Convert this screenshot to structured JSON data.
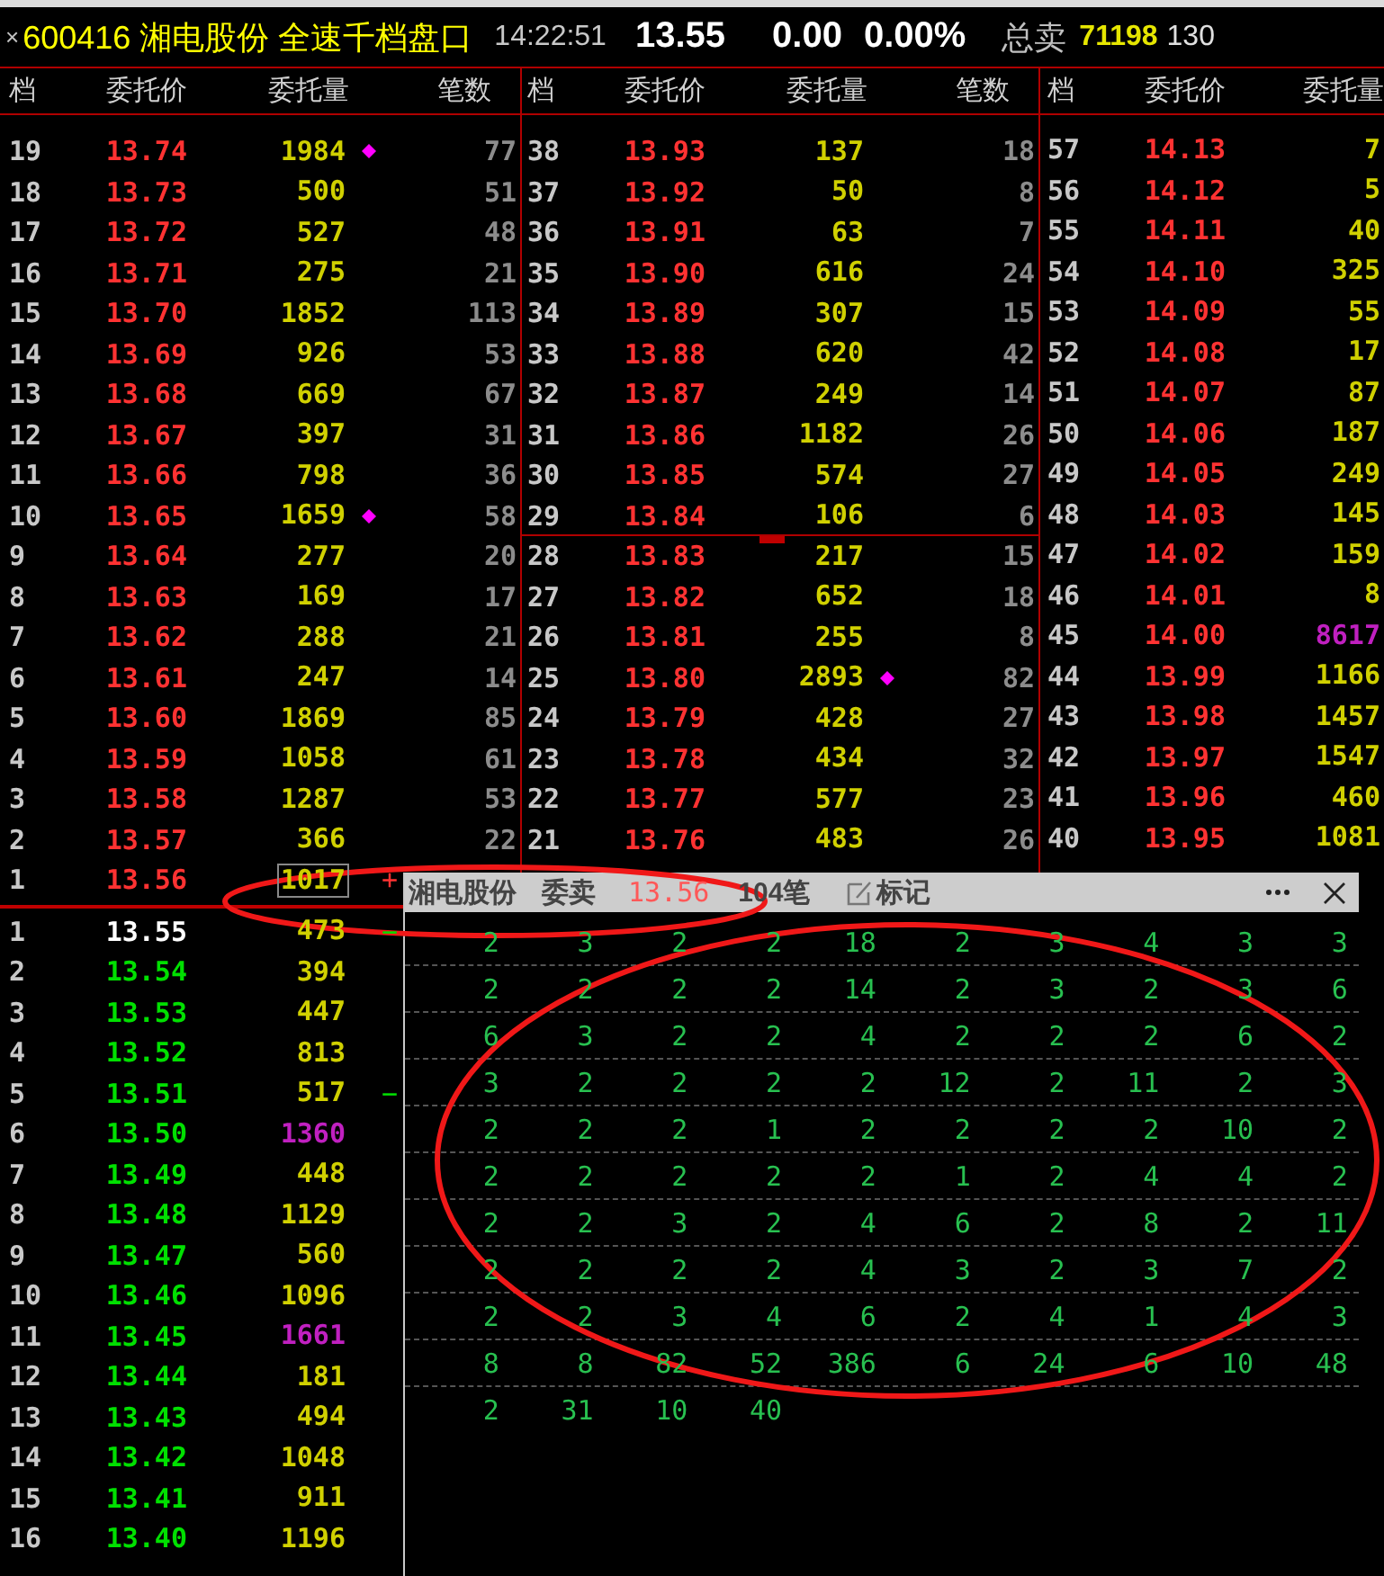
{
  "quote": {
    "close": "×",
    "title": "600416 湘电股份 全速千档盘口",
    "time": "14:22:51",
    "price": "13.55",
    "change": "0.00",
    "percent": "0.00%",
    "total_label": "总卖",
    "total_volume": "71198",
    "levels": "130"
  },
  "book": {
    "panels": [
      {
        "columns": [
          "档",
          "委托价",
          "委托量",
          "笔数"
        ],
        "groups": [
          {
            "kind": "ask",
            "rows": [
              {
                "level": "19",
                "price": "13.74",
                "volume": "1984",
                "count": "77",
                "kind": "flagged",
                "selected": false
              },
              {
                "level": "18",
                "price": "13.73",
                "volume": "500",
                "count": "51",
                "kind": "plain",
                "selected": false
              },
              {
                "level": "17",
                "price": "13.72",
                "volume": "527",
                "count": "48",
                "kind": "plain",
                "selected": false
              },
              {
                "level": "16",
                "price": "13.71",
                "volume": "275",
                "count": "21",
                "kind": "plain",
                "selected": false
              },
              {
                "level": "15",
                "price": "13.70",
                "volume": "1852",
                "count": "113",
                "kind": "plain",
                "selected": false
              },
              {
                "level": "14",
                "price": "13.69",
                "volume": "926",
                "count": "53",
                "kind": "plain",
                "selected": false
              },
              {
                "level": "13",
                "price": "13.68",
                "volume": "669",
                "count": "67",
                "kind": "plain",
                "selected": false
              },
              {
                "level": "12",
                "price": "13.67",
                "volume": "397",
                "count": "31",
                "kind": "plain",
                "selected": false
              },
              {
                "level": "11",
                "price": "13.66",
                "volume": "798",
                "count": "36",
                "kind": "plain",
                "selected": false
              },
              {
                "level": "10",
                "price": "13.65",
                "volume": "1659",
                "count": "58",
                "kind": "flagged",
                "selected": false
              },
              {
                "level": "9",
                "price": "13.64",
                "volume": "277",
                "count": "20",
                "kind": "plain",
                "selected": false
              },
              {
                "level": "8",
                "price": "13.63",
                "volume": "169",
                "count": "17",
                "kind": "plain",
                "selected": false
              },
              {
                "level": "7",
                "price": "13.62",
                "volume": "288",
                "count": "21",
                "kind": "plain",
                "selected": false
              },
              {
                "level": "6",
                "price": "13.61",
                "volume": "247",
                "count": "14",
                "kind": "plain",
                "selected": false
              },
              {
                "level": "5",
                "price": "13.60",
                "volume": "1869",
                "count": "85",
                "kind": "plain",
                "selected": false
              },
              {
                "level": "4",
                "price": "13.59",
                "volume": "1058",
                "count": "61",
                "kind": "plain",
                "selected": false
              },
              {
                "level": "3",
                "price": "13.58",
                "volume": "1287",
                "count": "53",
                "kind": "plain",
                "selected": false
              },
              {
                "level": "2",
                "price": "13.57",
                "volume": "366",
                "count": "22",
                "kind": "plain",
                "selected": false
              },
              {
                "level": "1",
                "price": "13.56",
                "volume": "1017",
                "sign": "+",
                "kind": "plain",
                "selected": true
              }
            ]
          },
          {
            "kind": "bid",
            "rows": [
              {
                "level": "1",
                "price": "13.55",
                "volume": "473",
                "sign": "−",
                "kind": "last",
                "selected": false
              },
              {
                "level": "2",
                "price": "13.54",
                "volume": "394",
                "kind": "plain",
                "selected": false
              },
              {
                "level": "3",
                "price": "13.53",
                "volume": "447",
                "kind": "plain",
                "selected": false
              },
              {
                "level": "4",
                "price": "13.52",
                "volume": "813",
                "kind": "plain",
                "selected": false
              },
              {
                "level": "5",
                "price": "13.51",
                "volume": "517",
                "sign": "−",
                "kind": "plain",
                "selected": false
              },
              {
                "level": "6",
                "price": "13.50",
                "volume": "1360",
                "color": "#c020c0",
                "kind": "plain",
                "selected": false
              },
              {
                "level": "7",
                "price": "13.49",
                "volume": "448",
                "kind": "plain",
                "selected": false
              },
              {
                "level": "8",
                "price": "13.48",
                "volume": "1129",
                "kind": "plain",
                "selected": false
              },
              {
                "level": "9",
                "price": "13.47",
                "volume": "560",
                "kind": "plain",
                "selected": false
              },
              {
                "level": "10",
                "price": "13.46",
                "volume": "1096",
                "kind": "plain",
                "selected": false
              },
              {
                "level": "11",
                "price": "13.45",
                "volume": "1661",
                "color": "#c020c0",
                "kind": "plain",
                "selected": false
              },
              {
                "level": "12",
                "price": "13.44",
                "volume": "181",
                "kind": "plain",
                "selected": false
              },
              {
                "level": "13",
                "price": "13.43",
                "volume": "494",
                "kind": "plain",
                "selected": false
              },
              {
                "level": "14",
                "price": "13.42",
                "volume": "1048",
                "kind": "plain",
                "selected": false
              },
              {
                "level": "15",
                "price": "13.41",
                "volume": "911",
                "kind": "plain",
                "selected": false
              },
              {
                "level": "16",
                "price": "13.40",
                "volume": "1196",
                "kind": "plain",
                "selected": false
              }
            ]
          }
        ]
      },
      {
        "columns": [
          "档",
          "委托价",
          "委托量",
          "笔数"
        ],
        "groups": [
          {
            "kind": "ask",
            "rows": [
              {
                "level": "38",
                "price": "13.93",
                "volume": "137",
                "count": "18",
                "kind": "plain",
                "selected": false
              },
              {
                "level": "37",
                "price": "13.92",
                "volume": "50",
                "count": "8",
                "kind": "plain",
                "selected": false
              },
              {
                "level": "36",
                "price": "13.91",
                "volume": "63",
                "count": "7",
                "kind": "plain",
                "selected": false
              },
              {
                "level": "35",
                "price": "13.90",
                "volume": "616",
                "count": "24",
                "kind": "plain",
                "selected": false
              },
              {
                "level": "34",
                "price": "13.89",
                "volume": "307",
                "count": "15",
                "kind": "plain",
                "selected": false
              },
              {
                "level": "33",
                "price": "13.88",
                "volume": "620",
                "count": "42",
                "kind": "plain",
                "selected": false
              },
              {
                "level": "32",
                "price": "13.87",
                "volume": "249",
                "count": "14",
                "kind": "plain",
                "selected": false
              },
              {
                "level": "31",
                "price": "13.86",
                "volume": "1182",
                "count": "26",
                "kind": "plain",
                "selected": false
              },
              {
                "level": "30",
                "price": "13.85",
                "volume": "574",
                "count": "27",
                "kind": "plain",
                "selected": false
              },
              {
                "level": "29",
                "price": "13.84",
                "volume": "106",
                "count": "6",
                "kind": "plain",
                "selected": false
              }
            ]
          },
          {
            "kind": "ask",
            "rows": [
              {
                "level": "28",
                "price": "13.83",
                "volume": "217",
                "count": "15",
                "kind": "plain",
                "selected": false
              },
              {
                "level": "27",
                "price": "13.82",
                "volume": "652",
                "count": "18",
                "kind": "plain",
                "selected": false
              },
              {
                "level": "26",
                "price": "13.81",
                "volume": "255",
                "count": "8",
                "kind": "plain",
                "selected": false
              },
              {
                "level": "25",
                "price": "13.80",
                "volume": "2893",
                "count": "82",
                "kind": "flagged",
                "selected": false
              },
              {
                "level": "24",
                "price": "13.79",
                "volume": "428",
                "count": "27",
                "kind": "plain",
                "selected": false
              },
              {
                "level": "23",
                "price": "13.78",
                "volume": "434",
                "count": "32",
                "kind": "plain",
                "selected": false
              },
              {
                "level": "22",
                "price": "13.77",
                "volume": "577",
                "count": "23",
                "kind": "plain",
                "selected": false
              },
              {
                "level": "21",
                "price": "13.76",
                "volume": "483",
                "count": "26",
                "kind": "plain",
                "selected": false
              }
            ]
          }
        ]
      },
      {
        "columns": [
          "档",
          "委托价",
          "委托量"
        ],
        "groups": [
          {
            "kind": "ask",
            "rows": [
              {
                "level": "57",
                "price": "14.13",
                "volume": "7",
                "kind": "plain",
                "selected": false
              },
              {
                "level": "56",
                "price": "14.12",
                "volume": "5",
                "kind": "plain",
                "selected": false
              },
              {
                "level": "55",
                "price": "14.11",
                "volume": "40",
                "kind": "plain",
                "selected": false
              },
              {
                "level": "54",
                "price": "14.10",
                "volume": "325",
                "kind": "plain",
                "selected": false
              },
              {
                "level": "53",
                "price": "14.09",
                "volume": "55",
                "kind": "plain",
                "selected": false
              },
              {
                "level": "52",
                "price": "14.08",
                "volume": "17",
                "kind": "plain",
                "selected": false
              },
              {
                "level": "51",
                "price": "14.07",
                "volume": "87",
                "kind": "plain",
                "selected": false
              },
              {
                "level": "50",
                "price": "14.06",
                "volume": "187",
                "kind": "plain",
                "selected": false
              },
              {
                "level": "49",
                "price": "14.05",
                "volume": "249",
                "kind": "plain",
                "selected": false
              },
              {
                "level": "48",
                "price": "14.03",
                "volume": "145",
                "kind": "plain",
                "selected": false
              },
              {
                "level": "47",
                "price": "14.02",
                "volume": "159",
                "kind": "plain",
                "selected": false
              },
              {
                "level": "46",
                "price": "14.01",
                "volume": "8",
                "kind": "plain",
                "selected": false
              },
              {
                "level": "45",
                "price": "14.00",
                "volume": "8617",
                "color": "#c020c0",
                "kind": "plain",
                "selected": false
              },
              {
                "level": "44",
                "price": "13.99",
                "volume": "1166",
                "kind": "plain",
                "selected": false
              },
              {
                "level": "43",
                "price": "13.98",
                "volume": "1457",
                "kind": "plain",
                "selected": false
              },
              {
                "level": "42",
                "price": "13.97",
                "volume": "1547",
                "kind": "plain",
                "selected": false
              },
              {
                "level": "41",
                "price": "13.96",
                "volume": "460",
                "kind": "plain",
                "selected": false
              },
              {
                "level": "40",
                "price": "13.95",
                "volume": "1081",
                "kind": "plain",
                "selected": false
              }
            ]
          }
        ]
      }
    ]
  },
  "popup": {
    "stock": "湘电股份",
    "side": "委卖",
    "price": "13.56",
    "orders": "104笔",
    "mark_label": "标记",
    "rows": [
      [
        "2",
        "3",
        "2",
        "2",
        "18",
        "2",
        "3",
        "4",
        "3",
        "3"
      ],
      [
        "2",
        "2",
        "2",
        "2",
        "14",
        "2",
        "3",
        "2",
        "3",
        "6"
      ],
      [
        "6",
        "3",
        "2",
        "2",
        "4",
        "2",
        "2",
        "2",
        "6",
        "2"
      ],
      [
        "3",
        "2",
        "2",
        "2",
        "2",
        "12",
        "2",
        "11",
        "2",
        "3"
      ],
      [
        "2",
        "2",
        "2",
        "1",
        "2",
        "2",
        "2",
        "2",
        "10",
        "2"
      ],
      [
        "2",
        "2",
        "2",
        "2",
        "2",
        "1",
        "2",
        "4",
        "4",
        "2"
      ],
      [
        "2",
        "2",
        "3",
        "2",
        "4",
        "6",
        "2",
        "8",
        "2",
        "11"
      ],
      [
        "2",
        "2",
        "2",
        "2",
        "4",
        "3",
        "2",
        "3",
        "7",
        "2"
      ],
      [
        "2",
        "2",
        "3",
        "4",
        "6",
        "2",
        "4",
        "1",
        "4",
        "3"
      ],
      [
        "8",
        "8",
        "82",
        "52",
        "386",
        "6",
        "24",
        "6",
        "10",
        "48"
      ],
      [
        "2",
        "31",
        "10",
        "40"
      ]
    ]
  },
  "annotations": [
    {
      "kind": "ellipse"
    },
    {
      "kind": "ellipse"
    }
  ]
}
